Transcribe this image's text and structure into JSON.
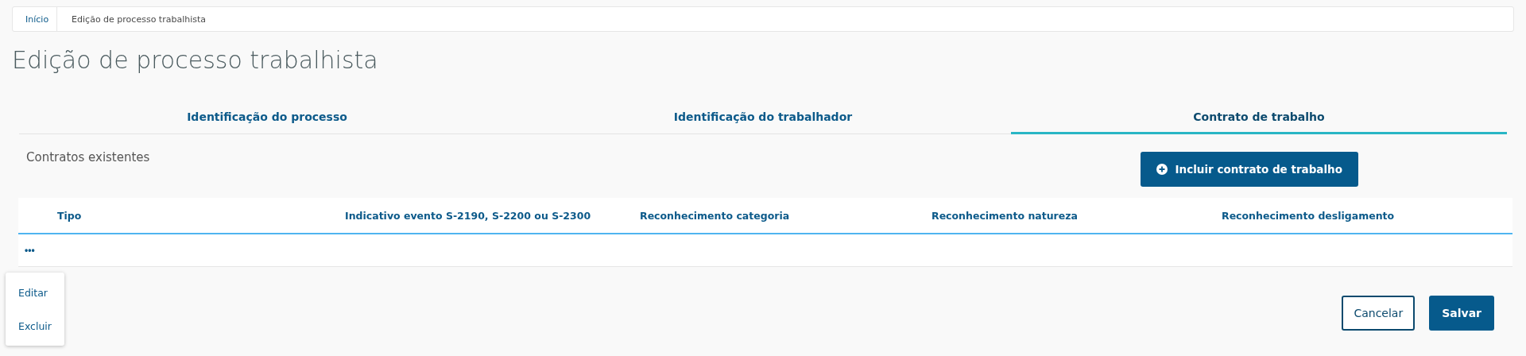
{
  "breadcrumb": [
    {
      "label": "Início"
    },
    {
      "label": "Edição de processo trabalhista"
    }
  ],
  "title": "Edição de processo trabalhista",
  "tabs": [
    {
      "label": "Identificação do processo",
      "selected": false
    },
    {
      "label": "Identificação do trabalhador",
      "selected": false
    },
    {
      "label": "Contrato de trabalho",
      "selected": true
    }
  ],
  "section_title": "Contratos existentes",
  "add_button": "Incluir contrato de trabalho",
  "table": {
    "columns": [
      "Tipo",
      "Indicativo evento S-2190, S-2200 ou S-2300",
      "Reconhecimento categoria",
      "Reconhecimento natureza",
      "Reconhecimento desligamento"
    ],
    "rows": [
      {
        "actions": "•••"
      }
    ]
  },
  "row_menu": {
    "items": [
      "Editar",
      "Excluir"
    ]
  },
  "buttons": [
    {
      "label": "Cancelar",
      "kind": "secondary"
    },
    {
      "label": "Salvar",
      "kind": "primary"
    }
  ]
}
